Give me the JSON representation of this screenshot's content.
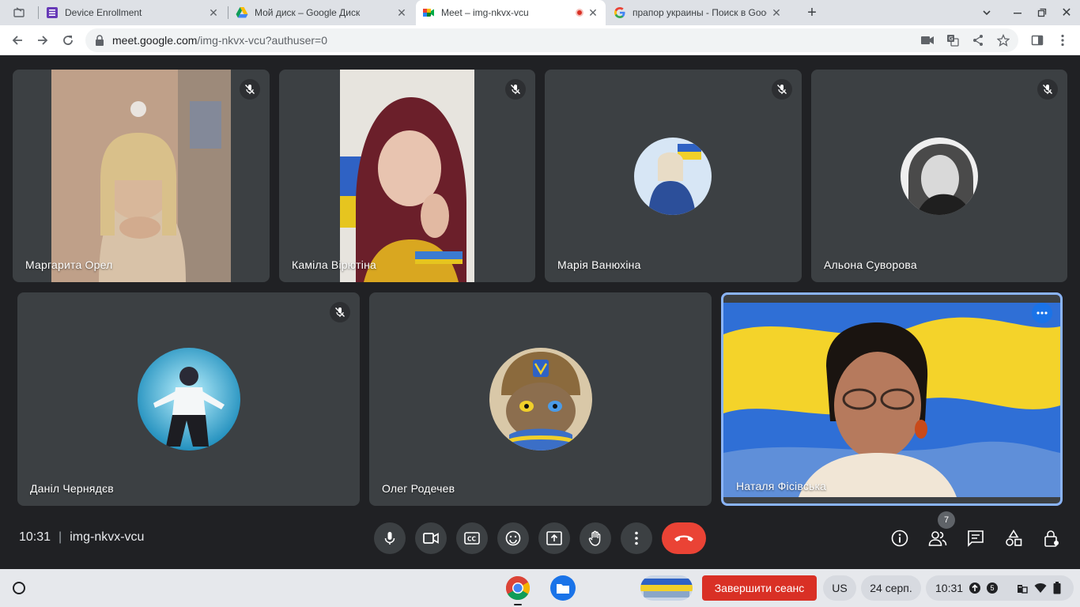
{
  "browser": {
    "tabs": [
      {
        "title": "",
        "active": false
      },
      {
        "title": "Device Enrollment",
        "active": false
      },
      {
        "title": "Мой диск – Google Диск",
        "active": false
      },
      {
        "title": "Meet – img-nkvx-vcu",
        "active": true
      },
      {
        "title": "прапор украины - Поиск в Google",
        "active": false
      }
    ],
    "new_tab_label": "+",
    "url_host": "meet.google.com",
    "url_path": "/img-nkvx-vcu?authuser=0"
  },
  "meet": {
    "participants": [
      {
        "name": "Маргарита Орел",
        "muted": true,
        "kind": "video"
      },
      {
        "name": "Каміла Вірютіна",
        "muted": true,
        "kind": "video"
      },
      {
        "name": "Марія Ванюхіна",
        "muted": true,
        "kind": "avatar"
      },
      {
        "name": "Альона Суворова",
        "muted": true,
        "kind": "avatar"
      },
      {
        "name": "Даніл Чернядєв",
        "muted": true,
        "kind": "avatar"
      },
      {
        "name": "Олег Родечев",
        "muted": false,
        "kind": "avatar"
      },
      {
        "name": "Наталя Фісівська",
        "muted": false,
        "kind": "video",
        "pinned_self": true
      }
    ],
    "time": "10:31",
    "meeting_code": "img-nkvx-vcu",
    "people_count": "7"
  },
  "shelf": {
    "signout_label": "Завершити сеанс",
    "ime": "US",
    "date": "24 серп.",
    "time": "10:31",
    "notif_count": "5"
  },
  "colors": {
    "stage": "#202124",
    "tile": "#3c4043",
    "end_call": "#ea4335",
    "signout": "#d93025",
    "ukraine_blue": "#2f6fd6",
    "ukraine_yellow": "#f4d32a"
  }
}
